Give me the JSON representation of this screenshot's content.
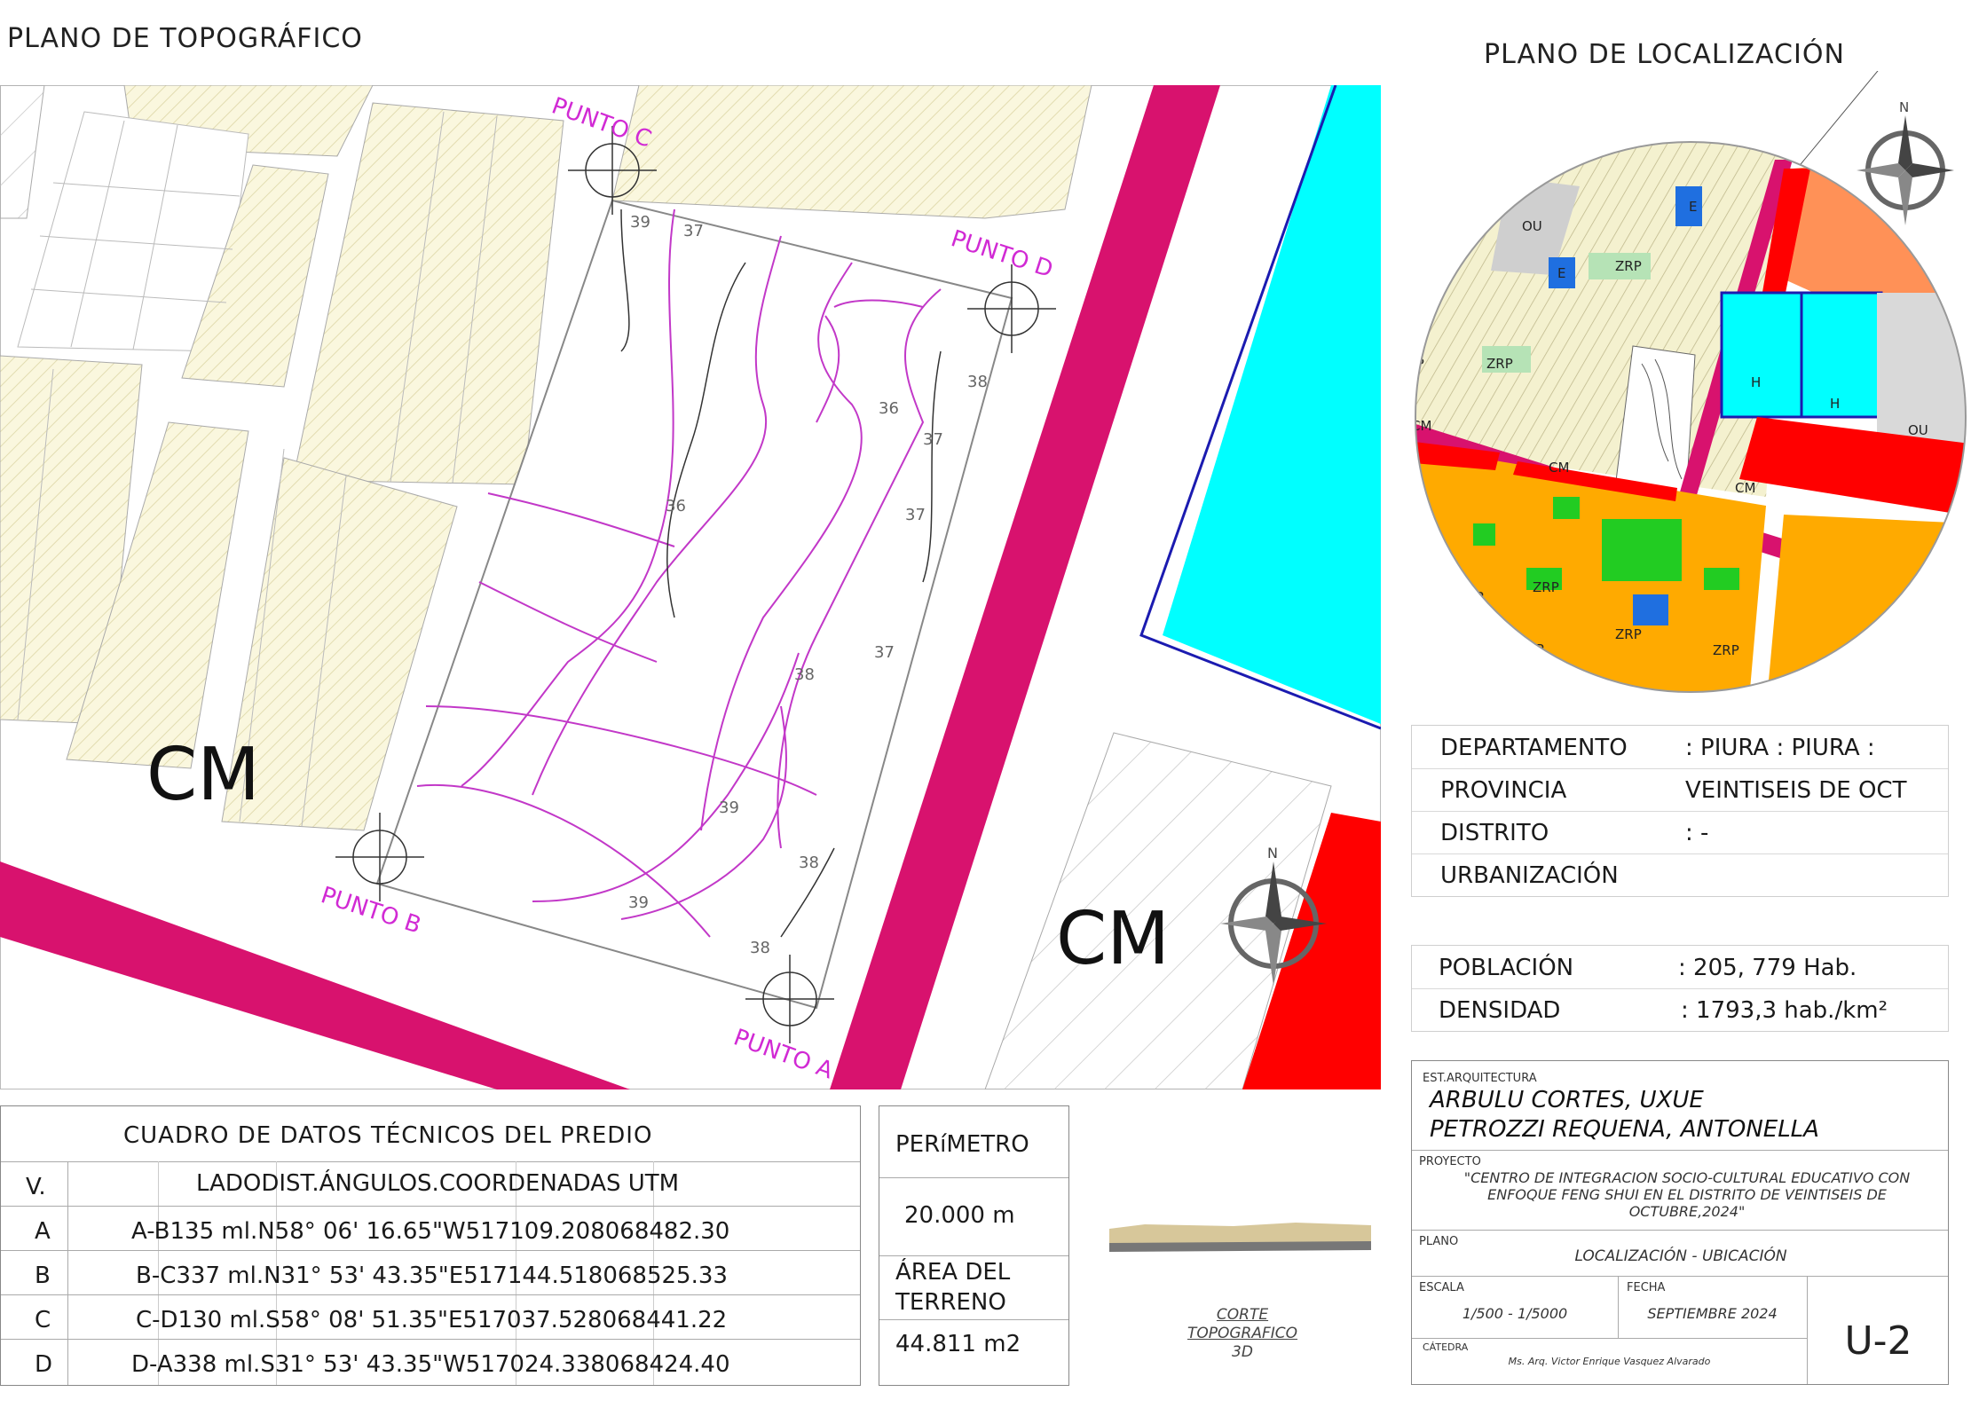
{
  "titles": {
    "topo": "PLANO DE TOPOGRÁFICO",
    "loc": "PLANO DE LOCALIZACIÓN"
  },
  "topo_map": {
    "points": [
      "PUNTO C",
      "PUNTO D",
      "PUNTO B",
      "PUNTO A"
    ],
    "zones": [
      "CM",
      "CM"
    ],
    "contours": [
      "39",
      "37",
      "38",
      "36",
      "36",
      "37",
      "37",
      "38",
      "39",
      "39",
      "38",
      "38",
      "37"
    ],
    "north": "N"
  },
  "loc_map": {
    "labels": [
      "OU",
      "E",
      "ZRP",
      "E",
      "U",
      "ZRP",
      "ZRP",
      "CM",
      "CM",
      "H",
      "H",
      "OU",
      "CM",
      "ZRP",
      "ZRP",
      "ZRP",
      "ZRP",
      "ZRP",
      "P"
    ],
    "north": "N"
  },
  "location": {
    "rows": [
      {
        "label": "DEPARTAMENTO",
        "value": ":   PIURA   :   PIURA   :"
      },
      {
        "label": "PROVINCIA",
        "value": "VEINTISEIS DE OCT"
      },
      {
        "label": "DISTRITO",
        "value": ": -"
      },
      {
        "label": "URBANIZACIÓN",
        "value": ""
      }
    ]
  },
  "population": {
    "rows": [
      {
        "label": "POBLACIÓN",
        "value": ": 205, 779 Hab."
      },
      {
        "label": "DENSIDAD",
        "value": ": 1793,3 hab./km²"
      }
    ]
  },
  "tech_table": {
    "title": "CUADRO DE DATOS TÉCNICOS DEL PREDIO",
    "header_v": "V.",
    "header": "LADODIST.ÁNGULOS.COORDENADAS UTM",
    "rows": [
      {
        "v": "A",
        "text": "A-B135 ml.N58° 06' 16.65\"W517109.208068482.30"
      },
      {
        "v": "B",
        "text": "B-C337 ml.N31° 53' 43.35\"E517144.518068525.33"
      },
      {
        "v": "C",
        "text": "C-D130 ml.S58° 08' 51.35\"E517037.528068441.22"
      },
      {
        "v": "D",
        "text": "D-A338 ml.S31° 53' 43.35\"W517024.338068424.40"
      }
    ]
  },
  "perimeter": {
    "label": "PERíMETRO",
    "value": "20.000 m",
    "area_label": "ÁREA  DEL TERRENO",
    "area_value": "44.811 m2"
  },
  "section": {
    "caption": [
      "CORTE",
      "TOPOGRAFICO",
      "3D"
    ]
  },
  "title_block": {
    "school_label": "EST.ARQUITECTURA",
    "authors": [
      "ARBULU CORTES, UXUE",
      "PETROZZI REQUENA, ANTONELLA"
    ],
    "project_label": "PROYECTO",
    "project": [
      "\"CENTRO DE INTEGRACION SOCIO-CULTURAL EDUCATIVO CON",
      "ENFOQUE FENG SHUI EN EL DISTRITO DE VEINTISEIS DE",
      "OCTUBRE,2024\""
    ],
    "plan_label": "PLANO",
    "plan": "LOCALIZACIÓN - UBICACIÓN",
    "scale_label": "ESCALA",
    "scale": "1/500 - 1/5000",
    "date_label": "FECHA",
    "date": "SEPTIEMBRE 2024",
    "chair_label": "CÁTEDRA",
    "chair": "Ms. Arq. Victor Enrique Vasquez Alvarado",
    "sheet": "U-2"
  },
  "colors": {
    "magenta": "#d8126e",
    "cyan": "#00ffff",
    "red": "#ff0000",
    "orange": "#ff9157",
    "yellow_lot": "#f9f6dc",
    "blue": "#1f6fe0",
    "green": "#22cc22",
    "amber": "#ffaa00",
    "contour": "#c238c8"
  }
}
